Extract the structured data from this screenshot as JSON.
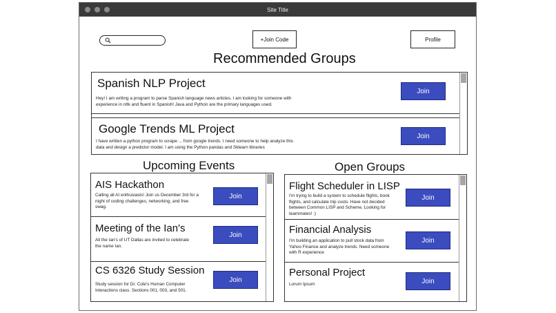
{
  "window": {
    "title": "Site Title"
  },
  "header": {
    "join_code_label": "+Join Code",
    "profile_label": "Profile",
    "search": {
      "value": "",
      "placeholder": ""
    }
  },
  "recommended": {
    "heading": "Recommended Groups",
    "items": [
      {
        "title": "Spanish NLP Project",
        "description": "Hey! I am writing a program to parse Spanish language news articles. I am looking for someone with experience in nltk and fluent in Spanish! Java and Python are the primary languages used.",
        "join_label": "Join"
      },
      {
        "title": "Google Trends ML Project",
        "description": "I have written a python program to scrape ... from google trends. I need someone to help analyze this data and design a predictor model. I am using the Python pandas and Sklearn libraries",
        "join_label": "Join"
      }
    ]
  },
  "events": {
    "heading": "Upcoming Events",
    "items": [
      {
        "title": "AIS Hackathon",
        "description": "Calling all AI enthusiasts! Join us December 3rd for a night of coding challenges, networking, and free swag.",
        "join_label": "Join"
      },
      {
        "title": "Meeting of the Ian's",
        "description": "All the Ian's of UT Dallas are invited to celebrate the name Ian.",
        "join_label": "Join"
      },
      {
        "title": "CS 6326 Study Session",
        "description": "Study session for Dr. Cole's Human Computer Interactions class. Sections 001, 003, and 501.",
        "join_label": "Join"
      }
    ]
  },
  "open_groups": {
    "heading": "Open Groups",
    "items": [
      {
        "title": "Flight Scheduler in LISP",
        "description": "I'm trying to build a system to schedule flights, book flights, and calculate trip costs. Have not decided between Common LISP and Scheme. Looking for teammates! :)",
        "join_label": "Join"
      },
      {
        "title": "Financial Analysis",
        "description": "I'm building an application to pull stock data from Yahoo Finance and analyze trends. Need someone with R experience",
        "join_label": "Join"
      },
      {
        "title": "Personal Project",
        "description": "Lorum Ipsum",
        "join_label": "Join"
      }
    ]
  },
  "colors": {
    "titlebar": "#3a3a3a",
    "join_button": "#3b4cbf",
    "border": "#333333"
  }
}
